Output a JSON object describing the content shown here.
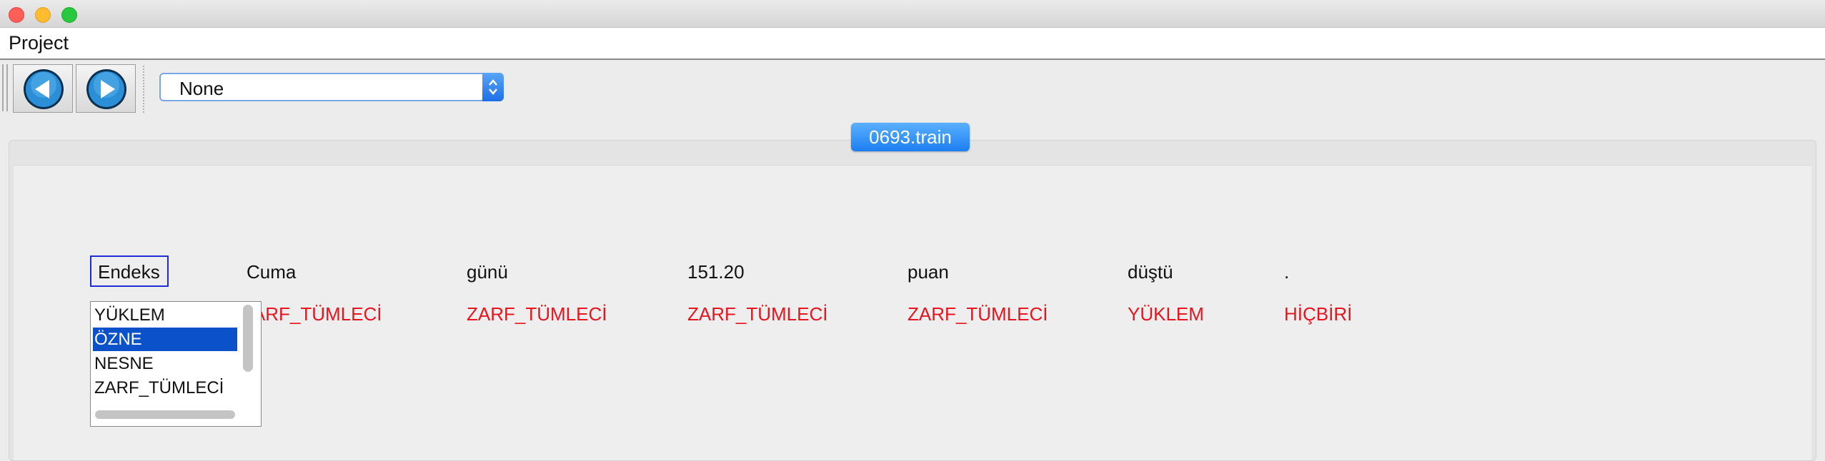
{
  "menu": {
    "project": "Project"
  },
  "toolbar": {
    "back_icon": "left-arrow-circle-icon",
    "forward_icon": "right-arrow-circle-icon",
    "combo_value": "None"
  },
  "tab": {
    "label": "0693.train"
  },
  "sentence": {
    "words": [
      "Endeks",
      "Cuma",
      "günü",
      "151.20",
      "puan",
      "düştü",
      "."
    ],
    "tags": [
      "ZARF_TÜMLECİ",
      "ZARF_TÜMLECİ",
      "ZARF_TÜMLECİ",
      "ZARF_TÜMLECİ",
      "YÜKLEM",
      "HİÇBİRİ"
    ]
  },
  "listbox": {
    "options": [
      "YÜKLEM",
      "ÖZNE",
      "NESNE",
      "ZARF_TÜMLECİ"
    ],
    "selected": "ÖZNE"
  },
  "colors": {
    "tag_red": "#e8141e",
    "selection_blue": "#0b51c9",
    "tab_blue": "#1d7ef0",
    "word_border": "#1e2bd6"
  }
}
